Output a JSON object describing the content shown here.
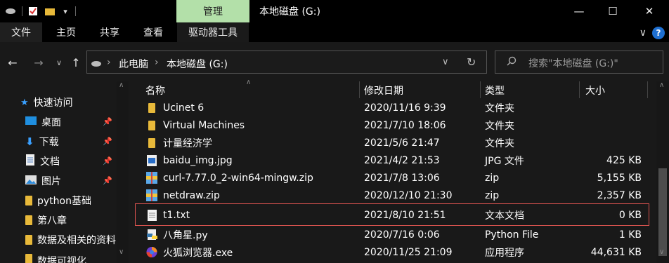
{
  "titlebar": {
    "manage_label": "管理",
    "title": "本地磁盘 (G:)",
    "minimize_label": "—",
    "maximize_label": "☐",
    "close_label": "✕"
  },
  "ribbon": {
    "tabs": [
      {
        "label": "文件"
      },
      {
        "label": "主页"
      },
      {
        "label": "共享"
      },
      {
        "label": "查看"
      },
      {
        "label": "驱动器工具"
      }
    ],
    "expand_label": "∨",
    "help_label": "?"
  },
  "address": {
    "crumbs": [
      "此电脑",
      "本地磁盘 (G:)"
    ],
    "separator": "›",
    "refresh_label": "↻",
    "dropdown_label": "∨"
  },
  "search": {
    "placeholder": "搜索\"本地磁盘 (G:)\""
  },
  "sidebar": {
    "items": [
      {
        "label": "快速访问",
        "icon": "star-icon"
      },
      {
        "label": "桌面",
        "icon": "desktop-icon"
      },
      {
        "label": "下载",
        "icon": "download-icon"
      },
      {
        "label": "文档",
        "icon": "document-icon"
      },
      {
        "label": "图片",
        "icon": "picture-icon"
      },
      {
        "label": "python基础",
        "icon": "folder-icon"
      },
      {
        "label": "第八章",
        "icon": "folder-icon"
      },
      {
        "label": "数据及相关的资料",
        "icon": "folder-icon"
      },
      {
        "label": "数据可视化",
        "icon": "folder-icon"
      }
    ]
  },
  "columns": {
    "name": "名称",
    "date": "修改日期",
    "type": "类型",
    "size": "大小"
  },
  "files": [
    {
      "name": "Ucinet 6",
      "date": "2020/11/16 9:39",
      "type": "文件夹",
      "size": "",
      "icon": "folder-icon"
    },
    {
      "name": "Virtual Machines",
      "date": "2021/7/10 18:06",
      "type": "文件夹",
      "size": "",
      "icon": "folder-icon"
    },
    {
      "name": "计量经济学",
      "date": "2021/5/6 21:47",
      "type": "文件夹",
      "size": "",
      "icon": "folder-icon"
    },
    {
      "name": "baidu_img.jpg",
      "date": "2021/4/2 21:53",
      "type": "JPG 文件",
      "size": "425 KB",
      "icon": "image-file-icon"
    },
    {
      "name": "curl-7.77.0_2-win64-mingw.zip",
      "date": "2021/7/8 13:06",
      "type": "zip",
      "size": "5,155 KB",
      "icon": "zip-file-icon"
    },
    {
      "name": "netdraw.zip",
      "date": "2020/12/10 21:30",
      "type": "zip",
      "size": "2,357 KB",
      "icon": "zip-file-icon"
    },
    {
      "name": "t1.txt",
      "date": "2021/8/10 21:51",
      "type": "文本文档",
      "size": "0 KB",
      "icon": "text-file-icon"
    },
    {
      "name": "八角星.py",
      "date": "2020/7/16 0:06",
      "type": "Python File",
      "size": "1 KB",
      "icon": "python-file-icon"
    },
    {
      "name": "火狐浏览器.exe",
      "date": "2020/11/25 21:09",
      "type": "应用程序",
      "size": "44,631 KB",
      "icon": "firefox-icon"
    }
  ],
  "selected_file": "t1.txt",
  "colors": {
    "manage_tab": "#b3e0a9",
    "folder": "#e8b93a",
    "selection_border": "#d9534f",
    "help": "#1e6fd1"
  }
}
